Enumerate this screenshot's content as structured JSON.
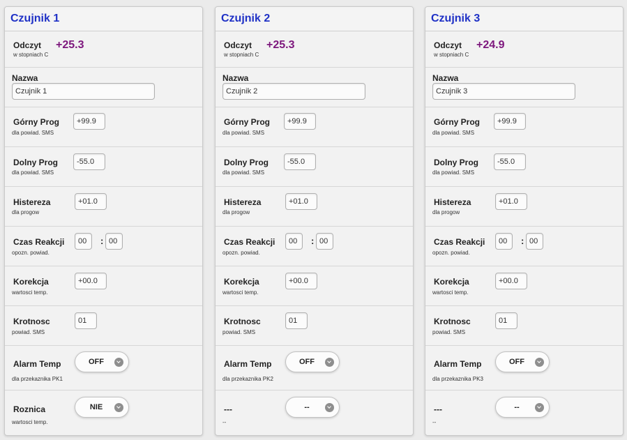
{
  "panels": [
    {
      "title": "Czujnik 1",
      "odczyt": {
        "label": "Odczyt",
        "sub": "w stopniach C",
        "value": "+25.3"
      },
      "nazwa": {
        "label": "Nazwa",
        "value": "Czujnik 1"
      },
      "gorny_prog": {
        "label": "Górny Prog",
        "sub": "dla powiad. SMS",
        "value": "+99.9"
      },
      "dolny_prog": {
        "label": "Dolny Prog",
        "sub": "dla powiad. SMS",
        "value": "-55.0"
      },
      "histereza": {
        "label": "Histereza",
        "sub": "dla progow",
        "value": "+01.0"
      },
      "czas_reakcji": {
        "label": "Czas Reakcji",
        "sub": "opozn. powiad.",
        "minutes": "00",
        "separator": ":",
        "seconds": "00"
      },
      "korekcja": {
        "label": "Korekcja",
        "sub": "wartosci temp.",
        "value": "+00.0"
      },
      "krotnosc": {
        "label": "Krotnosc",
        "sub": "powiad. SMS",
        "value": "01"
      },
      "alarm_temp": {
        "label": "Alarm Temp",
        "sub": "dla przekaznika PK1",
        "value": "OFF"
      },
      "last": {
        "label": "Roznica",
        "sub": "wartosci temp.",
        "value": "NIE"
      }
    },
    {
      "title": "Czujnik 2",
      "odczyt": {
        "label": "Odczyt",
        "sub": "w stopniach C",
        "value": "+25.3"
      },
      "nazwa": {
        "label": "Nazwa",
        "value": "Czujnik 2"
      },
      "gorny_prog": {
        "label": "Górny Prog",
        "sub": "dla powiad. SMS",
        "value": "+99.9"
      },
      "dolny_prog": {
        "label": "Dolny Prog",
        "sub": "dla powiad. SMS",
        "value": "-55.0"
      },
      "histereza": {
        "label": "Histereza",
        "sub": "dla progow",
        "value": "+01.0"
      },
      "czas_reakcji": {
        "label": "Czas Reakcji",
        "sub": "opozn. powiad.",
        "minutes": "00",
        "separator": ":",
        "seconds": "00"
      },
      "korekcja": {
        "label": "Korekcja",
        "sub": "wartosci temp.",
        "value": "+00.0"
      },
      "krotnosc": {
        "label": "Krotnosc",
        "sub": "powiad. SMS",
        "value": "01"
      },
      "alarm_temp": {
        "label": "Alarm Temp",
        "sub": "dla przekaznika PK2",
        "value": "OFF"
      },
      "last": {
        "label": "---",
        "sub": "--",
        "value": "--"
      }
    },
    {
      "title": "Czujnik 3",
      "odczyt": {
        "label": "Odczyt",
        "sub": "w stopniach C",
        "value": "+24.9"
      },
      "nazwa": {
        "label": "Nazwa",
        "value": "Czujnik 3"
      },
      "gorny_prog": {
        "label": "Górny Prog",
        "sub": "dla powiad. SMS",
        "value": "+99.9"
      },
      "dolny_prog": {
        "label": "Dolny Prog",
        "sub": "dla powiad. SMS",
        "value": "-55.0"
      },
      "histereza": {
        "label": "Histereza",
        "sub": "dla progow",
        "value": "+01.0"
      },
      "czas_reakcji": {
        "label": "Czas Reakcji",
        "sub": "opozn. powiad.",
        "minutes": "00",
        "separator": ":",
        "seconds": "00"
      },
      "korekcja": {
        "label": "Korekcja",
        "sub": "wartosci temp.",
        "value": "+00.0"
      },
      "krotnosc": {
        "label": "Krotnosc",
        "sub": "powiad. SMS",
        "value": "01"
      },
      "alarm_temp": {
        "label": "Alarm Temp",
        "sub": "dla przekaznika PK3",
        "value": "OFF"
      },
      "last": {
        "label": "---",
        "sub": "--",
        "value": "--"
      }
    }
  ],
  "colors": {
    "title": "#1f31c6",
    "reading": "#7d177d"
  },
  "icons": {
    "select_arrow": "chevron-down-icon"
  }
}
